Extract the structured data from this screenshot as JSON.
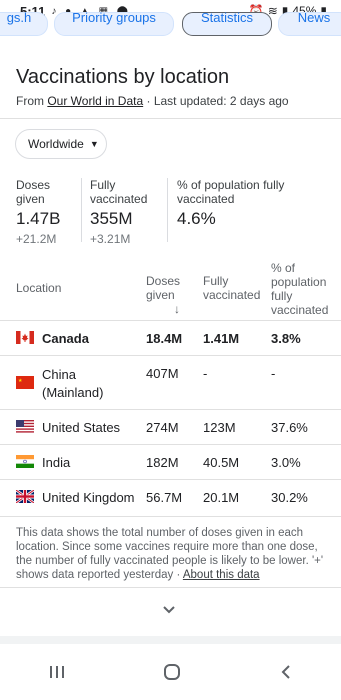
{
  "status_bar": {
    "time": "5:11",
    "battery": "45%"
  },
  "chips": [
    "gs.h",
    "Priority groups",
    "Statistics",
    "News"
  ],
  "card": {
    "title": "Vaccinations by location",
    "subtitle_prefix": "From ",
    "subtitle_link": "Our World in Data",
    "subtitle_suffix": " · Last updated: 2 days ago",
    "dropdown_label": "Worldwide"
  },
  "summary": [
    {
      "label": "Doses given",
      "value": "1.47B",
      "delta": "+21.2M"
    },
    {
      "label": "Fully vaccinated",
      "value": "355M",
      "delta": "+3.21M"
    },
    {
      "label": "% of population fully vaccinated",
      "value": "4.6%",
      "delta": ""
    }
  ],
  "table": {
    "headers": {
      "location": "Location",
      "doses": "Doses given",
      "sort_arrow": "↓",
      "fully": "Fully vaccinated",
      "pct": "% of population fully vaccinated"
    },
    "rows": [
      {
        "location": "Canada",
        "doses": "18.4M",
        "fully": "1.41M",
        "pct": "3.8%",
        "highlight": true,
        "flag": "canada-flag-icon"
      },
      {
        "location": "China (Mainland)",
        "doses": "407M",
        "fully": "-",
        "pct": "-",
        "highlight": false,
        "flag": "china-flag-icon"
      },
      {
        "location": "United States",
        "doses": "274M",
        "fully": "123M",
        "pct": "37.6%",
        "highlight": false,
        "flag": "us-flag-icon"
      },
      {
        "location": "India",
        "doses": "182M",
        "fully": "40.5M",
        "pct": "3.0%",
        "highlight": false,
        "flag": "india-flag-icon"
      },
      {
        "location": "United Kingdom",
        "doses": "56.7M",
        "fully": "20.1M",
        "pct": "30.2%",
        "highlight": false,
        "flag": "uk-flag-icon"
      }
    ]
  },
  "footnote": {
    "text": "This data shows the total number of doses given in each location. Since some vaccines require more than one dose, the number of fully vaccinated people is likely to be lower. '+' shows data reported yesterday",
    "sep": " · ",
    "link": "About this data"
  },
  "colors": {
    "accent": "#1a73e8",
    "chip_bg": "#e8f0fe"
  }
}
